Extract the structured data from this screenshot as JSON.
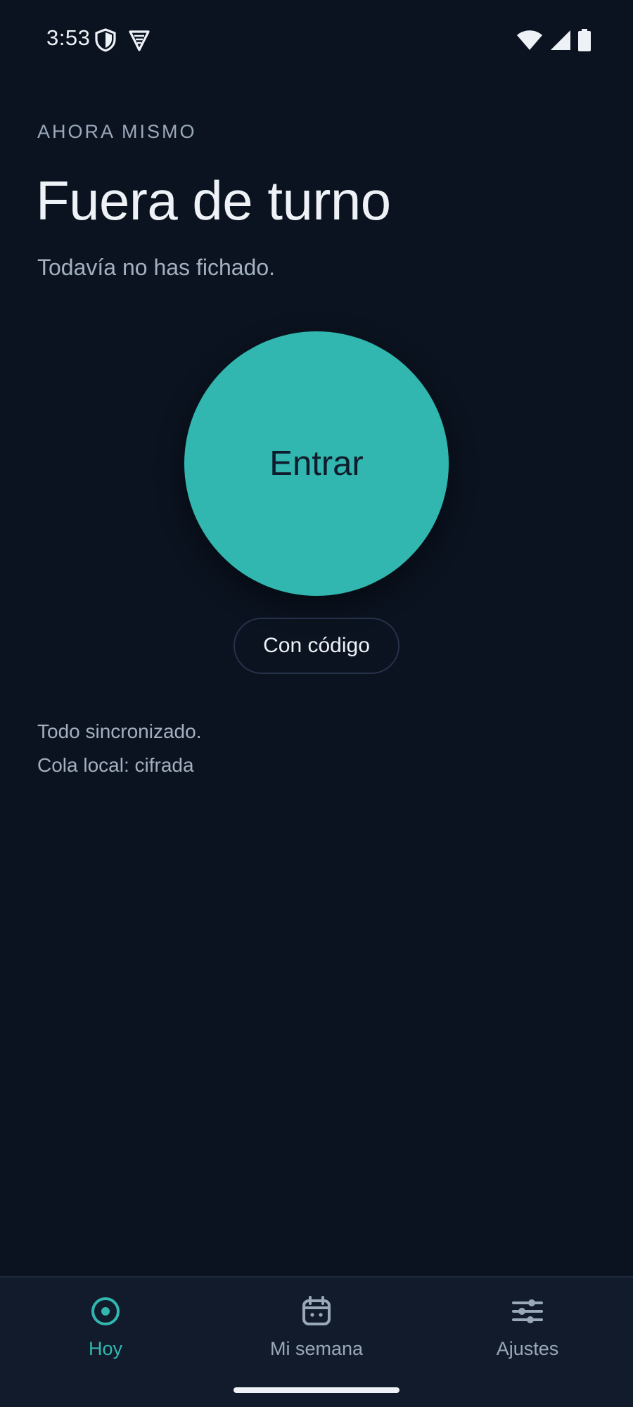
{
  "status_bar": {
    "time": "3:53",
    "icons": [
      "shield-icon",
      "vpn-triangle-icon",
      "wifi-icon",
      "cellular-signal-icon",
      "battery-icon"
    ]
  },
  "header": {
    "eyebrow": "AHORA MISMO",
    "title": "Fuera de turno",
    "subtitle": "Todavía no has fichado."
  },
  "actions": {
    "enter_label": "Entrar",
    "code_label": "Con código"
  },
  "status": {
    "sync": "Todo sincronizado.",
    "queue": "Cola local: cifrada"
  },
  "bottom_nav": {
    "items": [
      {
        "label": "Hoy",
        "icon": "target-icon",
        "active": true
      },
      {
        "label": "Mi semana",
        "icon": "calendar-icon",
        "active": false
      },
      {
        "label": "Ajustes",
        "icon": "sliders-icon",
        "active": false
      }
    ]
  },
  "colors": {
    "background": "#0b1320",
    "accent": "#31b7b0",
    "nav_background": "#111b2b",
    "muted_text": "#a4b0c0"
  }
}
